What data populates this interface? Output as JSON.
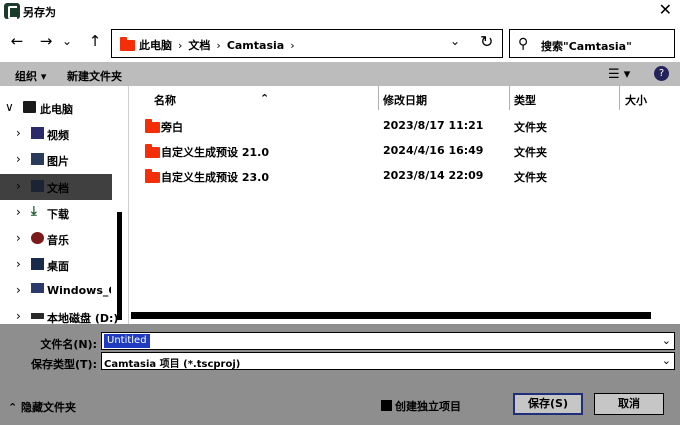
{
  "window": {
    "title": "另存为",
    "close_glyph": "✕"
  },
  "nav": {
    "back_glyph": "←",
    "forward_glyph": "→",
    "recent_glyph": "⌄",
    "up_glyph": "↑",
    "breadcrumb": [
      "此电脑",
      "文档",
      "Camtasia"
    ],
    "crumb_separator": "›",
    "dropdown_glyph": "⌄",
    "refresh_glyph": "↻",
    "search_glyph": "⚲",
    "search_placeholder": "搜索\"Camtasia\""
  },
  "toolbar": {
    "organize_label": "组织 ▾",
    "new_folder_label": "新建文件夹",
    "view_glyph": "☰ ▾",
    "help_glyph": "?"
  },
  "sidebar": {
    "items": [
      {
        "label": "此电脑",
        "icon": "computer-icon",
        "expanded": true
      },
      {
        "label": "视频",
        "icon": "video-icon"
      },
      {
        "label": "图片",
        "icon": "pictures-icon"
      },
      {
        "label": "文档",
        "icon": "documents-icon",
        "selected": true
      },
      {
        "label": "下载",
        "icon": "download-icon"
      },
      {
        "label": "音乐",
        "icon": "music-icon"
      },
      {
        "label": "桌面",
        "icon": "desktop-icon"
      },
      {
        "label": "Windows_OS (",
        "icon": "drive-icon"
      },
      {
        "label": "本地磁盘 (D:)",
        "icon": "drive-icon"
      }
    ],
    "expanded_glyph": "∨",
    "collapsed_glyph": "›"
  },
  "columns": {
    "name": "名称",
    "modified": "修改日期",
    "type": "类型",
    "size": "大小",
    "sort_glyph": "⌃"
  },
  "files": [
    {
      "name": "旁白",
      "modified": "2023/8/17 11:21",
      "type": "文件夹"
    },
    {
      "name": "自定义生成预设 21.0",
      "modified": "2024/4/16 16:49",
      "type": "文件夹"
    },
    {
      "name": "自定义生成预设 23.0",
      "modified": "2023/8/14 22:09",
      "type": "文件夹"
    }
  ],
  "form": {
    "filename_label": "文件名(N):",
    "filename_value": "Untitled",
    "filetype_label": "保存类型(T):",
    "filetype_value": "Camtasia 项目 (*.tscproj)",
    "dropdown_glyph": "⌄"
  },
  "footer": {
    "hide_folders_label": "⌃ 隐藏文件夹",
    "independent_project_label": "创建独立项目",
    "save_label": "保存(S)",
    "cancel_label": "取消"
  },
  "colors": {
    "folder": "#f32e08",
    "selection": "#1f3cc0",
    "bottom_panel": "#8e8e8e",
    "toolbar": "#bcbcbc"
  }
}
